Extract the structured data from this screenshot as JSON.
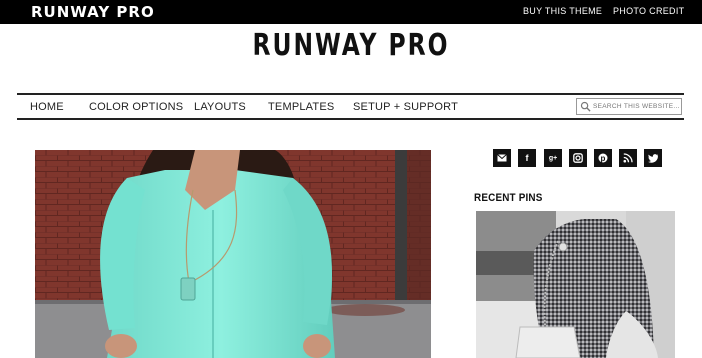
{
  "topbar": {
    "brand": "RUNWAY PRO",
    "links": [
      "BUY THIS THEME",
      "PHOTO CREDIT"
    ]
  },
  "header": {
    "site_title": "RUNWAY PRO"
  },
  "nav": {
    "items": [
      "HOME",
      "COLOR OPTIONS",
      "LAYOUTS",
      "TEMPLATES",
      "SETUP + SUPPORT"
    ],
    "search_placeholder": "SEARCH THIS WEBSITE..."
  },
  "sidebar": {
    "social_icons": [
      "email-icon",
      "facebook-icon",
      "google-plus-icon",
      "instagram-icon",
      "pinterest-icon",
      "rss-icon",
      "twitter-icon"
    ],
    "recent_pins_heading": "RECENT PINS"
  },
  "colors": {
    "topbar_bg": "#000000",
    "shirt": "#7fe3d4",
    "brick": "#8a3a30"
  }
}
